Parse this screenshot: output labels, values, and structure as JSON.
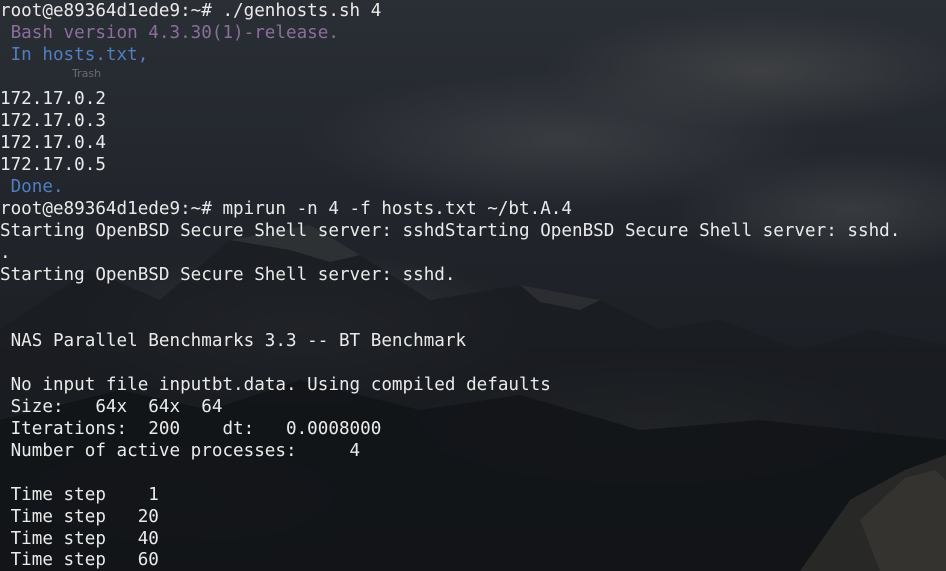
{
  "desktop": {
    "trash_label": "Trash"
  },
  "terminal": {
    "colors": {
      "text": "#eaeaea",
      "bash_version": "#8b6f9a",
      "info": "#4f7fc0"
    },
    "lines": [
      "root@e89364d1ede9:~# ./genhosts.sh 4",
      " Bash version 4.3.30(1)-release.",
      " In hosts.txt,",
      "",
      "172.17.0.2",
      "172.17.0.3",
      "172.17.0.4",
      "172.17.0.5",
      " Done.",
      "root@e89364d1ede9:~# mpirun -n 4 -f hosts.txt ~/bt.A.4",
      "Starting OpenBSD Secure Shell server: sshdStarting OpenBSD Secure Shell server: sshd.",
      ".",
      "Starting OpenBSD Secure Shell server: sshd.",
      "",
      "",
      " NAS Parallel Benchmarks 3.3 -- BT Benchmark",
      "",
      " No input file inputbt.data. Using compiled defaults",
      " Size:   64x  64x  64",
      " Iterations:  200    dt:   0.0008000",
      " Number of active processes:     4",
      "",
      " Time step    1",
      " Time step   20",
      " Time step   40",
      " Time step   60"
    ]
  }
}
